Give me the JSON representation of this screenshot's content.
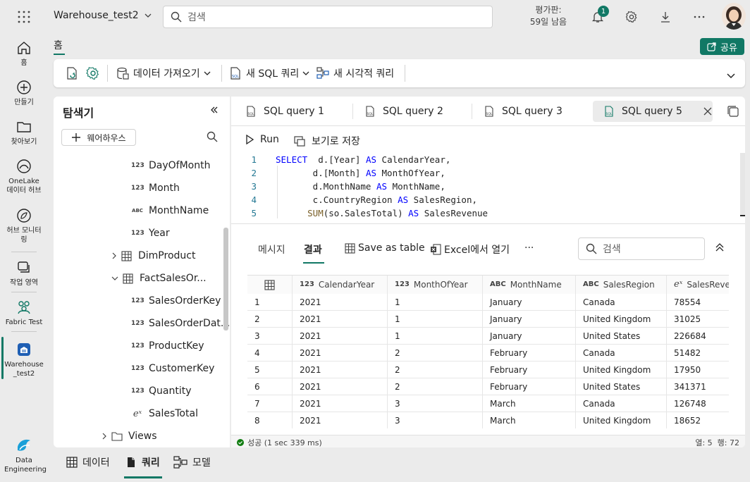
{
  "header": {
    "workspace": "Warehouse_test2",
    "search_placeholder": "검색",
    "trial_line1": "평가판:",
    "trial_line2": "59일 남음",
    "notification_count": "1"
  },
  "rail": [
    {
      "label": "홈",
      "icon": "home-icon"
    },
    {
      "label": "만들기",
      "icon": "create-icon"
    },
    {
      "label": "찾아보기",
      "icon": "browse-icon"
    },
    {
      "label": "OneLake 데이터 허브",
      "icon": "onelake-icon"
    },
    {
      "label": "허브 모니터링",
      "icon": "monitor-icon"
    },
    {
      "label": "작업 영역",
      "icon": "workspaces-icon"
    },
    {
      "label": "Fabric Test",
      "icon": "fabric-test-icon"
    },
    {
      "label": "Warehouse_test2",
      "icon": "warehouse-icon"
    },
    {
      "label": "Data Engineering",
      "icon": "data-engineering-icon"
    }
  ],
  "home_tab": "홈",
  "share_label": "공유",
  "ribbon": {
    "get_data": "데이터 가져오기",
    "new_sql": "새 SQL 쿼리",
    "new_visual": "새 시각적 쿼리"
  },
  "explorer": {
    "title": "탐색기",
    "warehouse_btn": "웨어하우스",
    "items": [
      {
        "type": "123",
        "label": "DayOfMonth"
      },
      {
        "type": "123",
        "label": "Month"
      },
      {
        "type": "ABC",
        "label": "MonthName"
      },
      {
        "type": "123",
        "label": "Year"
      },
      {
        "type": "table",
        "label": "DimProduct"
      },
      {
        "type": "table",
        "label": "FactSalesOr..."
      },
      {
        "type": "123",
        "label": "SalesOrderKey"
      },
      {
        "type": "123",
        "label": "SalesOrderDat..."
      },
      {
        "type": "123",
        "label": "ProductKey"
      },
      {
        "type": "123",
        "label": "CustomerKey"
      },
      {
        "type": "123",
        "label": "Quantity"
      },
      {
        "type": "ex",
        "label": "SalesTotal"
      },
      {
        "type": "folder",
        "label": "Views"
      }
    ]
  },
  "tabs": [
    "SQL query 1",
    "SQL query 2",
    "SQL query 3",
    "SQL query 5"
  ],
  "toolbar": {
    "run": "Run",
    "save_as_view": "보기로 저장"
  },
  "code": {
    "l1a": "SELECT",
    "l1b": "  d.[Year] ",
    "l1c": "AS",
    "l1d": " CalendarYear,",
    "l2a": "       d.[Month] ",
    "l2b": "AS",
    "l2c": " MonthOfYear,",
    "l3a": "       d.MonthName ",
    "l3b": "AS",
    "l3c": " MonthName,",
    "l4a": "       c.CountryRegion ",
    "l4b": "AS",
    "l4c": " SalesRegion,",
    "l5a": "      ",
    "l5b": "SUM",
    "l5c": "(so.SalesTotal) ",
    "l5d": "AS",
    "l5e": " SalesRevenue"
  },
  "results": {
    "tab_messages": "메시지",
    "tab_results": "결과",
    "save_table": "Save as table",
    "open_excel": "Excel에서 열기",
    "more": "···",
    "search_placeholder": "검색",
    "columns": [
      {
        "type": "123",
        "name": "CalendarYear"
      },
      {
        "type": "123",
        "name": "MonthOfYear"
      },
      {
        "type": "ABC",
        "name": "MonthName"
      },
      {
        "type": "ABC",
        "name": "SalesRegion"
      },
      {
        "type": "ex",
        "name": "SalesReve"
      }
    ],
    "rows": [
      [
        "1",
        "2021",
        "1",
        "January",
        "Canada",
        "78554"
      ],
      [
        "2",
        "2021",
        "1",
        "January",
        "United Kingdom",
        "31025"
      ],
      [
        "3",
        "2021",
        "1",
        "January",
        "United States",
        "226684"
      ],
      [
        "4",
        "2021",
        "2",
        "February",
        "Canada",
        "51482"
      ],
      [
        "5",
        "2021",
        "2",
        "February",
        "United Kingdom",
        "17950"
      ],
      [
        "6",
        "2021",
        "2",
        "February",
        "United States",
        "341371"
      ],
      [
        "7",
        "2021",
        "3",
        "March",
        "Canada",
        "126748"
      ],
      [
        "8",
        "2021",
        "3",
        "March",
        "United Kingdom",
        "18652"
      ]
    ]
  },
  "status": {
    "ok": "성공 (1 sec 339 ms)",
    "position": "열: 5  행: 72"
  },
  "bottom_tabs": [
    "데이터",
    "쿼리",
    "모델"
  ],
  "colors": {
    "accent": "#117865",
    "keyword": "#0000ff",
    "function": "#795e26"
  }
}
